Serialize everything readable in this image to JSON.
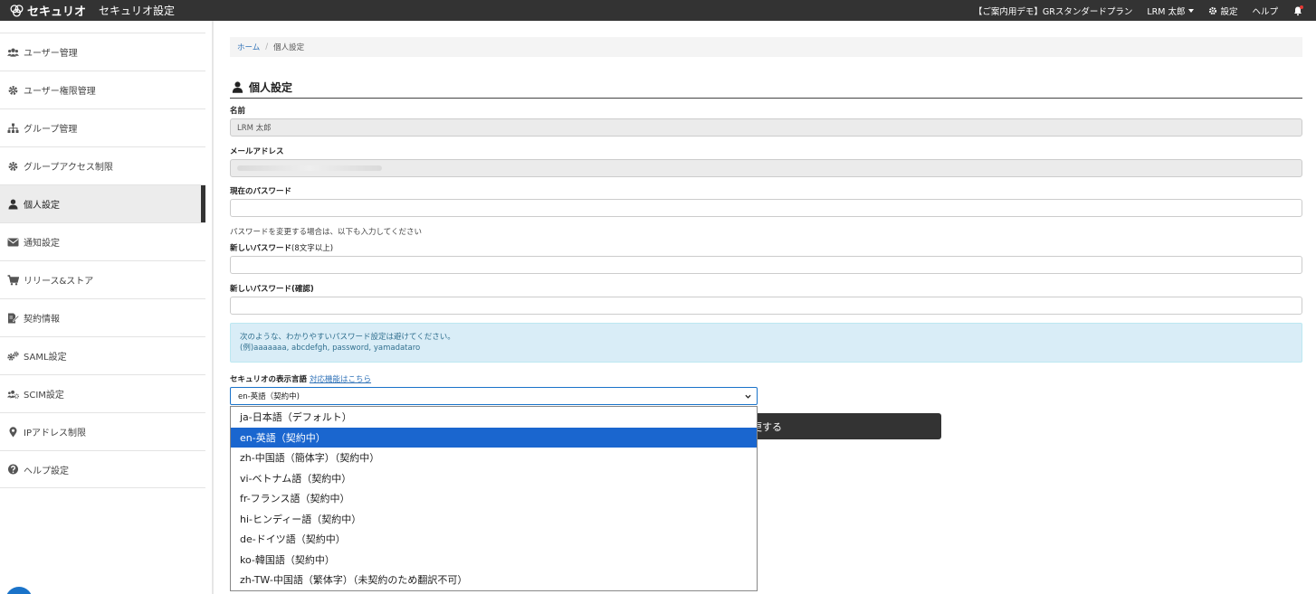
{
  "topbar": {
    "logo_text": "セキュリオ",
    "app_title": "セキュリオ設定",
    "plan_label": "【ご案内用デモ】GRスタンダードプラン",
    "user_name": "LRM 太郎",
    "settings_label": "設定",
    "help_label": "ヘルプ"
  },
  "sidebar": {
    "items": [
      {
        "label": "ユーザー管理",
        "icon": "users-icon"
      },
      {
        "label": "ユーザー権限管理",
        "icon": "gear-icon"
      },
      {
        "label": "グループ管理",
        "icon": "sitemap-icon"
      },
      {
        "label": "グループアクセス制限",
        "icon": "gear-icon"
      },
      {
        "label": "個人設定",
        "icon": "user-icon",
        "active": true
      },
      {
        "label": "通知設定",
        "icon": "envelope-icon"
      },
      {
        "label": "リリース&ストア",
        "icon": "cart-icon"
      },
      {
        "label": "契約情報",
        "icon": "contract-edit-icon"
      },
      {
        "label": "SAML設定",
        "icon": "gears-icon"
      },
      {
        "label": "SCIM設定",
        "icon": "users-gear-icon"
      },
      {
        "label": "IPアドレス制限",
        "icon": "map-marker-icon"
      },
      {
        "label": "ヘルプ設定",
        "icon": "question-circle-icon"
      }
    ]
  },
  "breadcrumb": {
    "home": "ホーム",
    "separator": "/",
    "current": "個人設定"
  },
  "page": {
    "title": "個人設定"
  },
  "form": {
    "name_label": "名前",
    "name_value": "LRM 太郎",
    "email_label": "メールアドレス",
    "current_password_label": "現在のパスワード",
    "password_hint": "パスワードを変更する場合は、以下も入力してください",
    "new_password_label": "新しいパスワード",
    "new_password_sub": "(8文字以上)",
    "confirm_password_label": "新しいパスワード(確認)",
    "alert_line1": "次のような、わかりやすいパスワード設定は避けてください。",
    "alert_line2": "(例)aaaaaaa, abcdefgh, password, yamadataro",
    "language_label": "セキュリオの表示言語",
    "language_link": "対応機能はこちら",
    "language_selected": "en-英語（契約中)",
    "submit_visible_text": "更する"
  },
  "language_options": [
    "ja-日本語（デフォルト）",
    "en-英語（契約中）",
    "zh-中国語（簡体字）（契約中）",
    "vi-ベトナム語（契約中）",
    "fr-フランス語（契約中）",
    "hi-ヒンディー語（契約中）",
    "de-ドイツ語（契約中）",
    "ko-韓国語（契約中）",
    "zh-TW-中国語（繁体字）（未契約のため翻訳不可）"
  ],
  "language_selected_index": 1,
  "colors": {
    "topbar": "#333333",
    "accent_blue": "#1a66cf",
    "alert_bg": "#d9edf7",
    "alert_text": "#31708f"
  }
}
